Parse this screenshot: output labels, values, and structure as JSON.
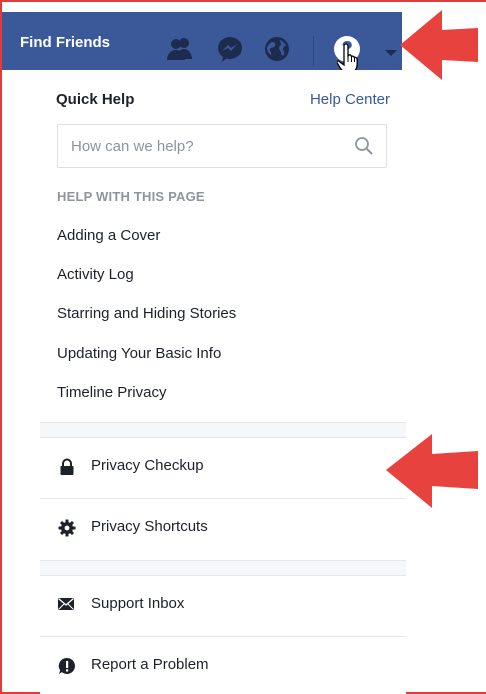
{
  "topbar": {
    "title": "Find Friends",
    "icons": [
      "friends-icon",
      "messenger-icon",
      "globe-icon",
      "help-icon",
      "chevron-down-icon"
    ]
  },
  "quick_help": {
    "title": "Quick Help",
    "help_center_link": "Help Center",
    "search": {
      "placeholder": "How can we help?",
      "value": ""
    },
    "section_heading": "HELP WITH THIS PAGE",
    "items": [
      "Adding a Cover",
      "Activity Log",
      "Starring and Hiding Stories",
      "Updating Your Basic Info",
      "Timeline Privacy"
    ]
  },
  "actions": {
    "privacy_checkup": "Privacy Checkup",
    "privacy_shortcuts": "Privacy Shortcuts",
    "support_inbox": "Support Inbox",
    "report_problem": "Report a Problem"
  },
  "colors": {
    "facebook_blue": "#3b5998",
    "link_blue": "#365899",
    "annotation_red": "#e8423f"
  }
}
